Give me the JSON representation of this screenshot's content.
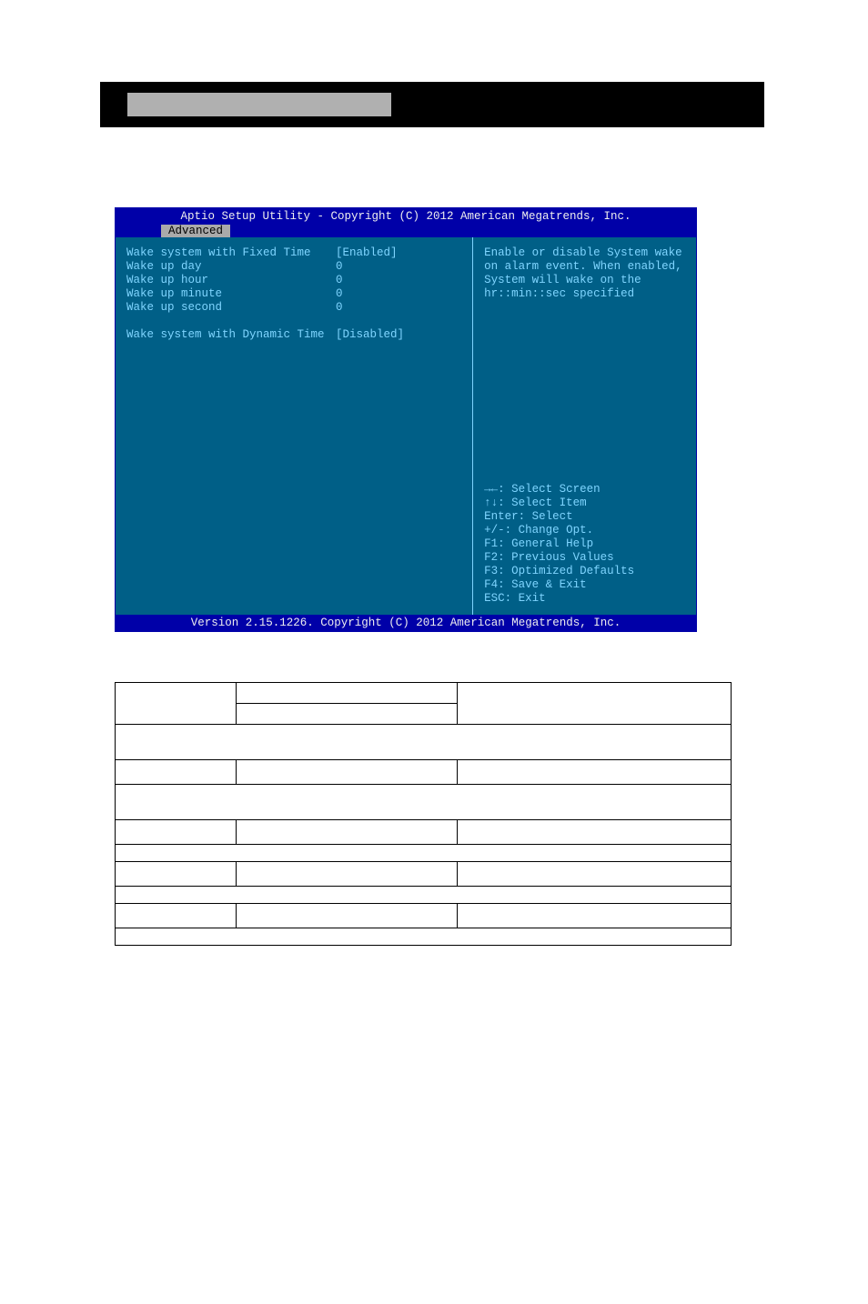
{
  "bios": {
    "title": "Aptio Setup Utility - Copyright (C) 2012 American Megatrends, Inc.",
    "tab": "Advanced",
    "rows": [
      {
        "label": "Wake system with Fixed Time",
        "value": "[Enabled]"
      },
      {
        "label": "Wake up day",
        "value": "0"
      },
      {
        "label": "Wake up hour",
        "value": "0"
      },
      {
        "label": "Wake up minute",
        "value": "0"
      },
      {
        "label": "Wake up second",
        "value": "0"
      }
    ],
    "row_spacer": "",
    "dynamic": {
      "label": "Wake system with Dynamic Time",
      "value": "[Disabled]"
    },
    "help_top": [
      "Enable or disable System wake",
      "on alarm event. When enabled,",
      "System will wake on the",
      "hr::min::sec specified"
    ],
    "help_keys": [
      "→←: Select Screen",
      "↑↓: Select Item",
      "Enter: Select",
      "+/-: Change Opt.",
      "F1: General Help",
      "F2: Previous Values",
      "F3: Optimized Defaults",
      "F4: Save & Exit",
      "ESC: Exit"
    ],
    "footer": "Version 2.15.1226. Copyright (C) 2012 American Megatrends, Inc."
  }
}
